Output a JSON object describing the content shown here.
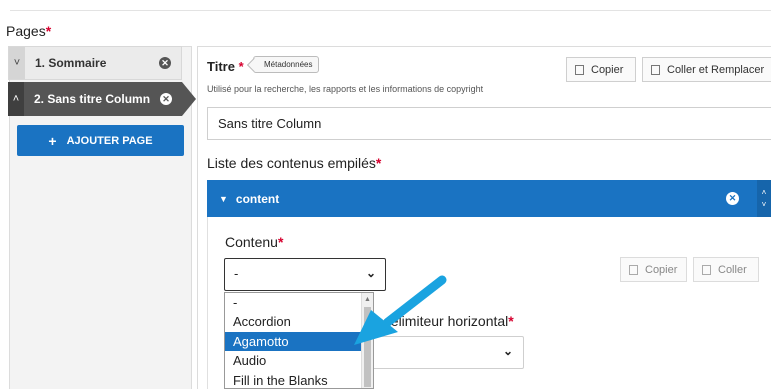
{
  "pages": {
    "title": "Pages",
    "required_mark": "*",
    "items": [
      {
        "label": "1. Sommaire",
        "chevron": "˅",
        "remove": "✕"
      },
      {
        "label": "2. Sans titre Column",
        "chevron": "˄",
        "remove": "✕"
      }
    ],
    "add_button": {
      "icon": "+",
      "label": "AJOUTER PAGE"
    }
  },
  "editor": {
    "titre_label": "Titre",
    "required_mark": "*",
    "meta_badge": "Métadonnées",
    "helper_text": "Utilisé pour la recherche, les rapports et les informations de copyright",
    "copy_label": "Copier",
    "paste_replace_label": "Coller et Remplacer",
    "title_value": "Sans titre Column",
    "list_label": "Liste des contenus empilés",
    "content_bar": {
      "caret": "▼",
      "label": "content",
      "close": "✕",
      "up": "˄",
      "down": "˅"
    },
    "contenu_label": "Contenu",
    "select_value": "-",
    "select_chevron": "⌄",
    "copy_small": "Copier",
    "paste_small": "Coller",
    "delim_label": "délimiteur horizontal",
    "second_select_chevron": "⌄"
  },
  "dropdown": {
    "options": [
      "-",
      "Accordion",
      "Agamotto",
      "Audio",
      "Fill in the Blanks"
    ],
    "selected": "Agamotto",
    "scroll_up": "▲"
  },
  "colors": {
    "accent": "#1a73c2",
    "required": "#d6002e",
    "arrow": "#1aa3e0"
  }
}
